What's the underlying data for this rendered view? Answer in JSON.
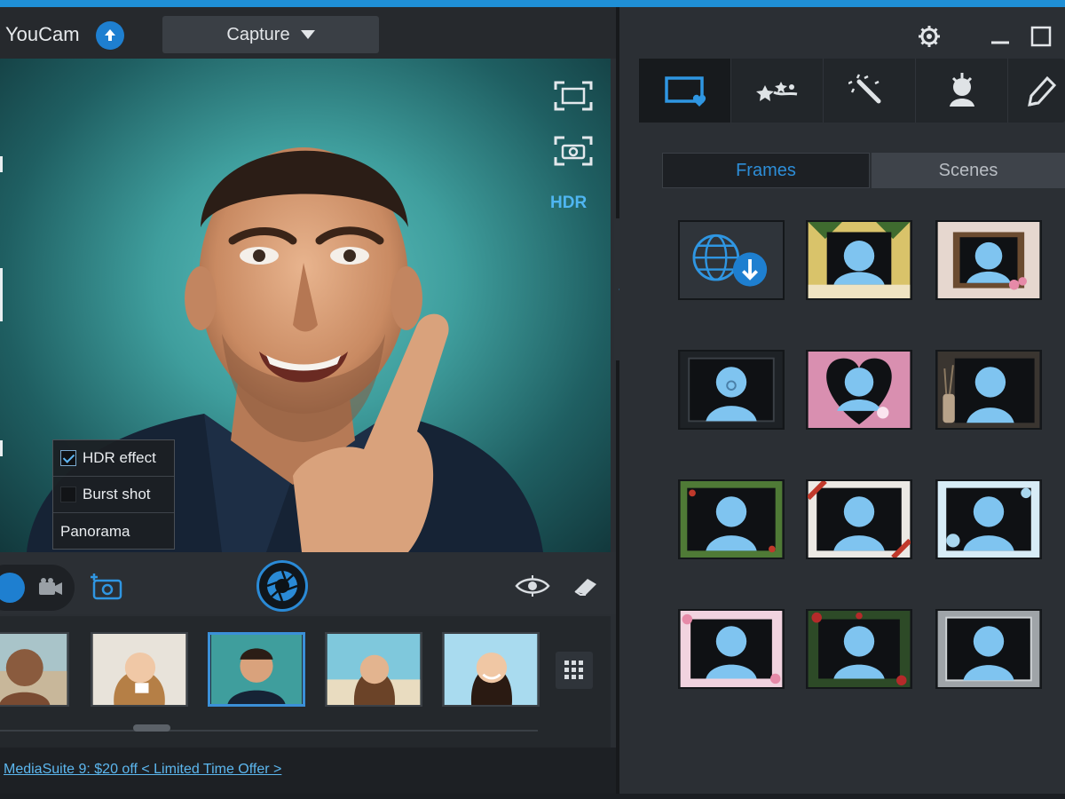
{
  "app": {
    "title": "YouCam"
  },
  "mode": {
    "label": "Capture"
  },
  "viewport": {
    "hdr_label": "HDR"
  },
  "capture_menu": {
    "items": [
      {
        "label": "HDR effect",
        "checked": true
      },
      {
        "label": "Burst shot",
        "checked": false
      },
      {
        "label": "Panorama",
        "checked": false
      }
    ]
  },
  "promo": {
    "text": "MediaSuite 9: $20 off  < Limited Time Offer >"
  },
  "panel": {
    "subtabs": [
      "Frames",
      "Scenes"
    ],
    "active_subtab": "Frames",
    "active_tool": "frames-icon"
  },
  "thumbnails": [
    {
      "name": "man-smiling-beach",
      "selected": false
    },
    {
      "name": "woman-coffee",
      "selected": false
    },
    {
      "name": "man-teal-background",
      "selected": true
    },
    {
      "name": "woman-beach",
      "selected": false
    },
    {
      "name": "woman-sky",
      "selected": false
    }
  ],
  "frames": [
    "download-frames",
    "cartoon-jungle",
    "wood-flower",
    "dark-portrait",
    "pink-heart",
    "vintage-vase",
    "green-vine",
    "red-ribbon",
    "blue-winter",
    "pink-floral",
    "red-roses",
    "silver-classic"
  ],
  "colors": {
    "accent": "#1e7fd0",
    "highlight": "#4fb6f2",
    "background": "#2b2f34"
  }
}
